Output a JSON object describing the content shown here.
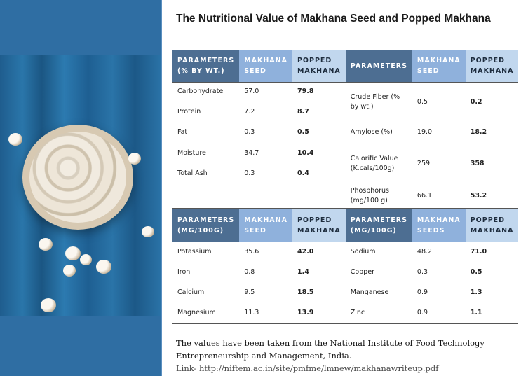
{
  "title": "The Nutritional Value of Makhana Seed and Popped Makhana",
  "table1": {
    "headers": [
      "PARAMETERS (% BY WT.)",
      "MAKHANA SEED",
      "POPPED MAKHANA",
      "PARAMETERS",
      "MAKHANA SEED",
      "POPPED MAKHANA"
    ],
    "rows": [
      [
        "Carbohydrate",
        "57.0",
        "79.8",
        "Crude Fiber (% by wt.)",
        "0.5",
        "0.2"
      ],
      [
        "Protein",
        "7.2",
        "8.7",
        "",
        "",
        ""
      ],
      [
        "Fat",
        "0.3",
        "0.5",
        "Amylose (%)",
        "19.0",
        "18.2"
      ],
      [
        "Moisture",
        "34.7",
        "10.4",
        "Calorific Value (K.cals/100g)",
        "259",
        "358"
      ],
      [
        "Total Ash",
        "0.3",
        "0.4",
        "",
        "",
        ""
      ],
      [
        "",
        "",
        "",
        "Phosphorus (mg/100 g)",
        "66.1",
        "53.2"
      ]
    ]
  },
  "table2": {
    "headers": [
      "PARAMETERS (MG/100G)",
      "MAKHANA SEED",
      "POPPED MAKHANA",
      "PARAMETERS (MG/100G)",
      "MAKHANA SEEDS",
      "POPPED MAKHANA"
    ],
    "rows": [
      [
        "Potassium",
        "35.6",
        "42.0",
        "Sodium",
        "48.2",
        "71.0"
      ],
      [
        "Iron",
        "0.8",
        "1.4",
        "Copper",
        "0.3",
        "0.5"
      ],
      [
        "Calcium",
        "9.5",
        "18.5",
        "Manganese",
        "0.9",
        "1.3"
      ],
      [
        "Magnesium",
        "11.3",
        "13.9",
        "Zinc",
        "0.9",
        "1.1"
      ]
    ]
  },
  "footer": {
    "line1": "The values have been taken from the National Institute of Food Technology",
    "line2": "Entrepreneurship and Management, India.",
    "link": "Link- http://niftem.ac.in/site/pmfme/lmnew/makhanawriteup.pdf"
  },
  "image": {
    "icon": "makhana-bowl-photo",
    "colors": {
      "wood": "#2a74a8",
      "bowl": "#d7c9b2"
    }
  }
}
